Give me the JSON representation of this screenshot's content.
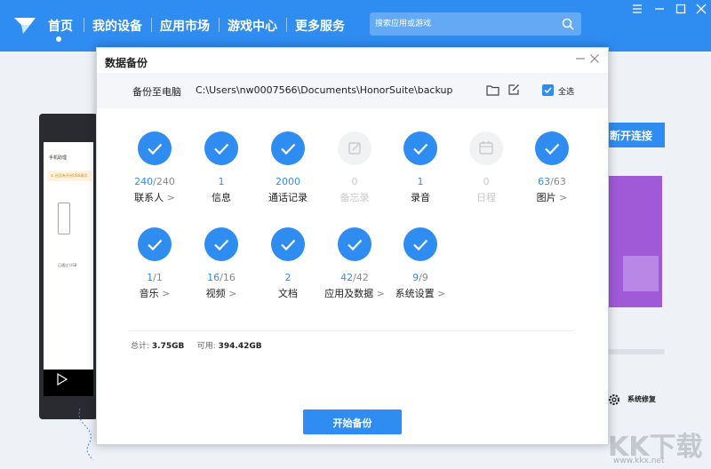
{
  "nav": {
    "items": [
      "首页",
      "我的设备",
      "应用市场",
      "游戏中心",
      "更多服务"
    ],
    "search_placeholder": "搜索应用或游戏",
    "colors": {
      "accent": "#2f8cf0"
    }
  },
  "background": {
    "phone_title": "手机助理",
    "phone_warning": "① 还没有开启USB调试",
    "phone_footer": "已通过 USB",
    "disconnect_button": "断开连接",
    "system_repair": "系统修复",
    "watermark": "KK下载",
    "watermark_url": "www.kkx.net"
  },
  "dialog": {
    "title": "数据备份",
    "backup_to_pc_label": "备份至电脑",
    "backup_path": "C:\\Users\\nw0007566\\Documents\\HonorSuite\\backup",
    "select_all_label": "全选",
    "items": [
      {
        "id": "contacts",
        "count": "240",
        "total": "240",
        "label": "联系人",
        "chevron": true,
        "enabled": true,
        "icon": "check-icon"
      },
      {
        "id": "messages",
        "count": "1",
        "total": "",
        "label": "信息",
        "chevron": false,
        "enabled": true,
        "icon": "check-icon"
      },
      {
        "id": "call-log",
        "count": "2000",
        "total": "",
        "label": "通话记录",
        "chevron": false,
        "enabled": true,
        "icon": "check-icon"
      },
      {
        "id": "memo",
        "count": "0",
        "total": "",
        "label": "备忘录",
        "chevron": false,
        "enabled": false,
        "icon": "memo-icon"
      },
      {
        "id": "recordings",
        "count": "1",
        "total": "",
        "label": "录音",
        "chevron": false,
        "enabled": true,
        "icon": "check-icon"
      },
      {
        "id": "calendar",
        "count": "0",
        "total": "",
        "label": "日程",
        "chevron": false,
        "enabled": false,
        "icon": "calendar-icon"
      },
      {
        "id": "photos",
        "count": "63",
        "total": "63",
        "label": "图片",
        "chevron": true,
        "enabled": true,
        "icon": "check-icon"
      },
      {
        "id": "music",
        "count": "1",
        "total": "1",
        "label": "音乐",
        "chevron": true,
        "enabled": true,
        "icon": "check-icon"
      },
      {
        "id": "videos",
        "count": "16",
        "total": "16",
        "label": "视频",
        "chevron": true,
        "enabled": true,
        "icon": "check-icon"
      },
      {
        "id": "documents",
        "count": "2",
        "total": "",
        "label": "文档",
        "chevron": false,
        "enabled": true,
        "icon": "check-icon"
      },
      {
        "id": "apps",
        "count": "42",
        "total": "42",
        "label": "应用及数据",
        "chevron": true,
        "enabled": true,
        "icon": "check-icon"
      },
      {
        "id": "settings",
        "count": "9",
        "total": "9",
        "label": "系统设置",
        "chevron": true,
        "enabled": true,
        "icon": "check-icon"
      }
    ],
    "summary": {
      "total_label": "总计:",
      "total_value": "3.75GB",
      "available_label": "可用:",
      "available_value": "394.42GB"
    },
    "start_button": "开始备份"
  }
}
